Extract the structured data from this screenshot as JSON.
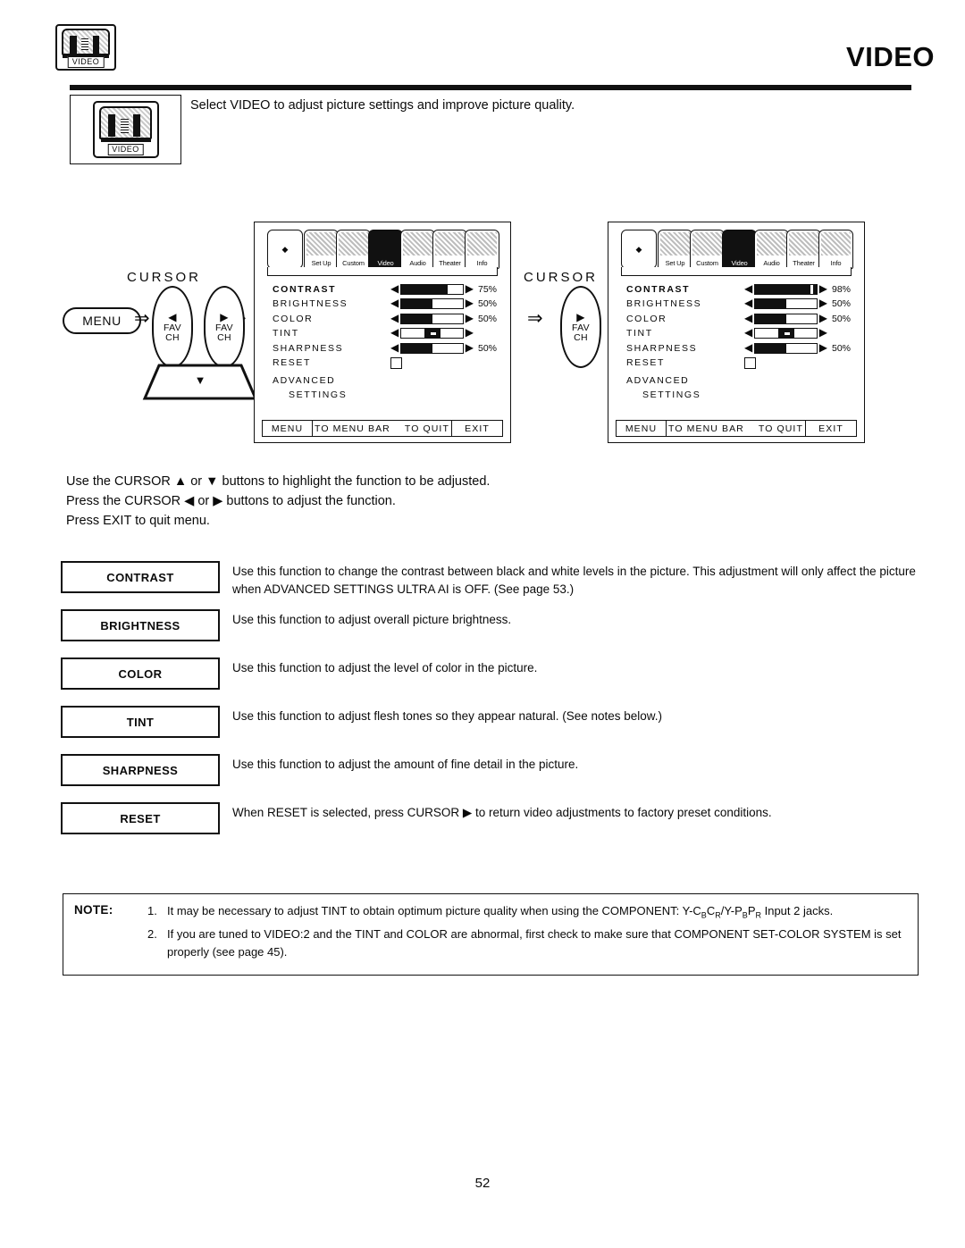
{
  "header": {
    "title": "VIDEO",
    "icon_label": "VIDEO",
    "icon_name": "video-tv-icon"
  },
  "intro": {
    "icon_label": "VIDEO",
    "text": "Select VIDEO to adjust picture settings and improve picture quality."
  },
  "flow": {
    "cursor_label_left": "CURSOR",
    "cursor_label_right": "CURSOR",
    "menu_key_label": "MENU",
    "petal_left": {
      "arrow": "◀",
      "line1": "FAV",
      "line2": "CH"
    },
    "petal_right": {
      "arrow": "▶",
      "line1": "FAV",
      "line2": "CH"
    },
    "petal_mid": {
      "arrow": "▶",
      "line1": "FAV",
      "line2": "CH"
    },
    "petal_down": {
      "arrow": "▼"
    },
    "arrow_glyph": "⇒"
  },
  "osd": {
    "menubar_tabs": [
      {
        "label": "",
        "icon": "cursor-pad-icon",
        "selected": false,
        "pad": true
      },
      {
        "label": "Set Up",
        "icon": "setup-icon",
        "selected": false
      },
      {
        "label": "Custom",
        "icon": "custom-palette-icon",
        "selected": false
      },
      {
        "label": "Video",
        "icon": "video-icon",
        "selected": true
      },
      {
        "label": "Audio",
        "icon": "audio-keyboard-icon",
        "selected": false
      },
      {
        "label": "Theater",
        "icon": "theater-projector-icon",
        "selected": false
      },
      {
        "label": "Info",
        "icon": "info-document-icon",
        "selected": false
      }
    ],
    "footer": {
      "menu": "MENU",
      "to_menu_bar": "TO MENU BAR",
      "to_quit": "TO QUIT",
      "exit": "EXIT"
    },
    "row_labels": {
      "contrast": "CONTRAST",
      "brightness": "BRIGHTNESS",
      "color": "COLOR",
      "tint": "TINT",
      "sharpness": "SHARPNESS",
      "reset": "RESET",
      "advanced": "ADVANCED",
      "settings": "SETTINGS"
    },
    "arrow_left": "◀",
    "arrow_right": "▶",
    "panels": [
      {
        "name": "before-adjustment",
        "values": {
          "contrast": {
            "percent": "75%",
            "fill": 75
          },
          "brightness": {
            "percent": "50%",
            "fill": 50
          },
          "color": {
            "percent": "50%",
            "fill": 50
          },
          "tint": {
            "percent": "",
            "fill": 50,
            "centered": true
          },
          "sharpness": {
            "percent": "50%",
            "fill": 50
          }
        }
      },
      {
        "name": "after-adjustment",
        "values": {
          "contrast": {
            "percent": "98%",
            "fill": 97
          },
          "brightness": {
            "percent": "50%",
            "fill": 50
          },
          "color": {
            "percent": "50%",
            "fill": 50
          },
          "tint": {
            "percent": "",
            "fill": 50,
            "centered": true
          },
          "sharpness": {
            "percent": "50%",
            "fill": 50
          }
        }
      }
    ]
  },
  "usage": {
    "line1": "Use the CURSOR ▲ or ▼ buttons to highlight the function to be adjusted.",
    "line2": "Press the CURSOR ◀ or ▶ buttons to adjust the function.",
    "line3": "Press EXIT to quit menu."
  },
  "functions": [
    {
      "key": "CONTRAST",
      "desc": "Use this function to change the contrast between black and white levels in the picture.  This adjustment will only affect the picture when ADVANCED SETTINGS ULTRA AI is OFF. (See page 53.)"
    },
    {
      "key": "BRIGHTNESS",
      "desc": "Use this function to adjust overall picture brightness."
    },
    {
      "key": "COLOR",
      "desc": "Use this function to adjust the level of color in the picture."
    },
    {
      "key": "TINT",
      "desc": "Use this function to adjust flesh tones so they appear natural. (See notes below.)"
    },
    {
      "key": "SHARPNESS",
      "desc": "Use this function to adjust the amount of fine detail in the picture."
    },
    {
      "key": "RESET",
      "desc": "When RESET is selected, press CURSOR ▶ to return video adjustments to factory preset conditions."
    }
  ],
  "note": {
    "label": "NOTE:",
    "items": [
      {
        "num": "1.",
        "part_a": "It may be necessary to adjust TINT to obtain optimum picture quality when using the COMPONENT: Y-C",
        "sub_a": "B",
        "part_b": "C",
        "sub_b": "R",
        "part_c": "/Y-P",
        "sub_c": "B",
        "part_d": "P",
        "sub_d": "R",
        "part_e": " Input 2 jacks."
      },
      {
        "num": "2.",
        "text": "If you are tuned to VIDEO:2 and the TINT and COLOR  are abnormal, first check to make sure that COMPONENT SET-COLOR SYSTEM is set properly (see page 45)."
      }
    ]
  },
  "page_number": "52",
  "colors": {
    "ink": "#0a0a0a",
    "paper": "#ffffff"
  }
}
